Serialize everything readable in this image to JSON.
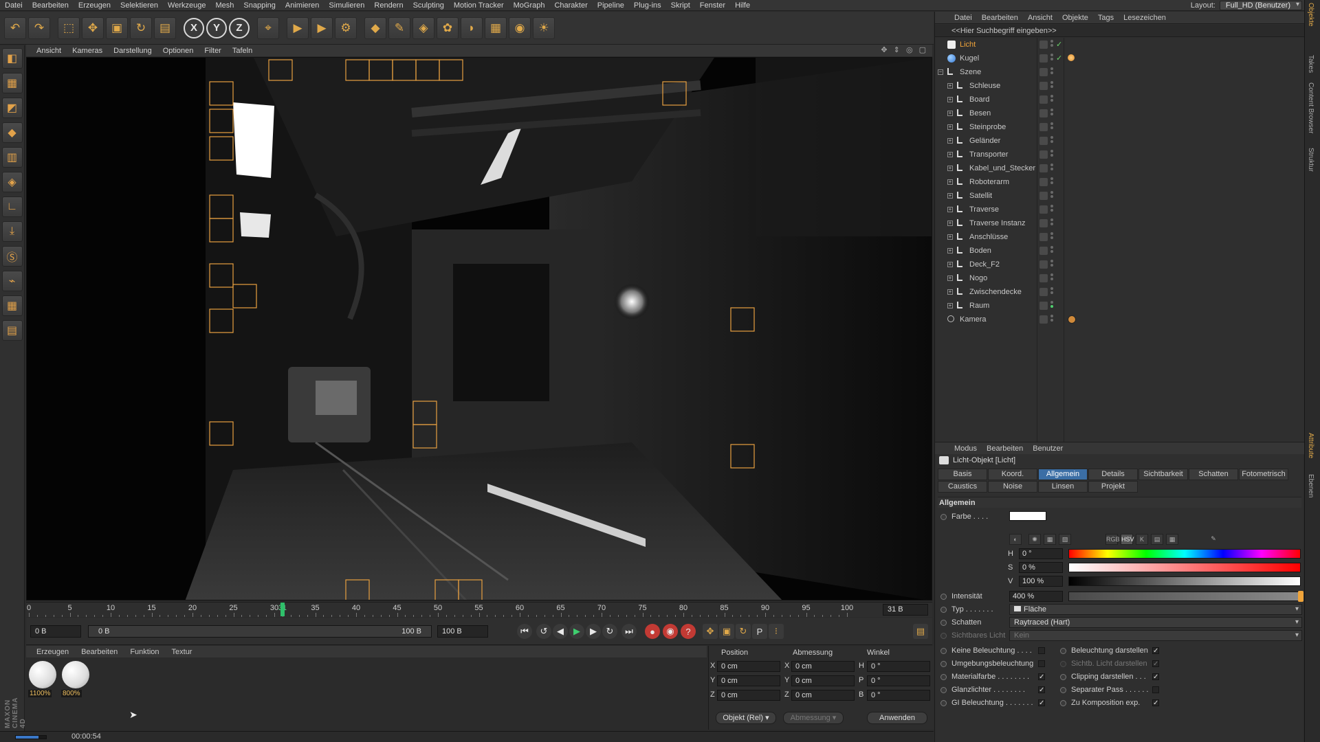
{
  "menubar": {
    "items": [
      "Datei",
      "Bearbeiten",
      "Erzeugen",
      "Selektieren",
      "Werkzeuge",
      "Mesh",
      "Snapping",
      "Animieren",
      "Simulieren",
      "Rendern",
      "Sculpting",
      "Motion Tracker",
      "MoGraph",
      "Charakter",
      "Pipeline",
      "Plug-ins",
      "Skript",
      "Fenster",
      "Hilfe"
    ],
    "layout_label": "Layout:",
    "layout_value": "Full_HD (Benutzer)"
  },
  "toolbar": {
    "icons": [
      "undo-icon",
      "redo-icon",
      "live-select-icon",
      "move-icon",
      "scale-icon",
      "rotate-icon",
      "render-region-icon",
      "x-axis-icon",
      "y-axis-icon",
      "z-axis-icon",
      "coordinate-system-icon",
      "render-view-icon",
      "render-picture-viewer-icon",
      "render-settings-icon",
      "cube-icon",
      "pen-icon",
      "subdivision-icon",
      "cloner-icon",
      "deformer-icon",
      "floor-icon",
      "camera-icon",
      "light-icon"
    ],
    "x_label": "X",
    "y_label": "Y",
    "z_label": "Z"
  },
  "lefttools": {
    "icons": [
      "model-mode-icon",
      "points-mode-icon",
      "edges-mode-icon",
      "polygons-mode-icon",
      "object-axis-icon",
      "texture-mode-icon",
      "workplane-icon",
      "snap-icon",
      "sculpt-icon",
      "magnet-icon",
      "grid-icon",
      "layer-icon"
    ]
  },
  "viewport": {
    "menu": [
      "Ansicht",
      "Kameras",
      "Darstellung",
      "Optionen",
      "Filter",
      "Tafeln"
    ]
  },
  "timeline": {
    "ticks": [
      "0",
      "5",
      "10",
      "15",
      "20",
      "25",
      "30",
      "31",
      "35",
      "40",
      "45",
      "50",
      "55",
      "60",
      "65",
      "70",
      "75",
      "80",
      "85",
      "90",
      "95",
      "100"
    ],
    "current_frame": "31 B",
    "playhead_frame": 31,
    "max_frame": 100
  },
  "playback": {
    "start_field": "0 B",
    "range_start": "0 B",
    "range_end": "100 B",
    "end_field": "100 B"
  },
  "material_manager": {
    "menu": [
      "Erzeugen",
      "Bearbeiten",
      "Funktion",
      "Textur"
    ],
    "materials": [
      {
        "tag": "1100%"
      },
      {
        "tag": "800%"
      }
    ]
  },
  "coordinates": {
    "headers": [
      "Position",
      "Abmessung",
      "Winkel"
    ],
    "rows": [
      {
        "pos_axis": "X",
        "pos": "0 cm",
        "size_axis": "X",
        "size": "0 cm",
        "rot_axis": "H",
        "rot": "0 °"
      },
      {
        "pos_axis": "Y",
        "pos": "0 cm",
        "size_axis": "Y",
        "size": "0 cm",
        "rot_axis": "P",
        "rot": "0 °"
      },
      {
        "pos_axis": "Z",
        "pos": "0 cm",
        "size_axis": "Z",
        "size": "0 cm",
        "rot_axis": "B",
        "rot": "0 °"
      }
    ],
    "mode": "Objekt (Rel)",
    "size_mode": "Abmessung",
    "apply": "Anwenden"
  },
  "statusbar": {
    "time": "00:00:54",
    "progress": 0.75
  },
  "object_manager": {
    "menu": [
      "Datei",
      "Bearbeiten",
      "Ansicht",
      "Objekte",
      "Tags",
      "Lesezeichen"
    ],
    "search_placeholder": "<<Hier Suchbegriff eingeben>>",
    "objects": [
      {
        "name": "Licht",
        "level": 0,
        "icon": "light",
        "selected": true,
        "color": "#f0a43a"
      },
      {
        "name": "Kugel",
        "level": 0,
        "icon": "sphere"
      },
      {
        "name": "Szene",
        "level": 0,
        "icon": "null",
        "expanded": true
      },
      {
        "name": "Schleuse",
        "level": 1,
        "icon": "null"
      },
      {
        "name": "Board",
        "level": 1,
        "icon": "null"
      },
      {
        "name": "Besen",
        "level": 1,
        "icon": "null"
      },
      {
        "name": "Steinprobe",
        "level": 1,
        "icon": "null"
      },
      {
        "name": "Geländer",
        "level": 1,
        "icon": "null"
      },
      {
        "name": "Transporter",
        "level": 1,
        "icon": "null"
      },
      {
        "name": "Kabel_und_Stecker",
        "level": 1,
        "icon": "null"
      },
      {
        "name": "Roboterarm",
        "level": 1,
        "icon": "null"
      },
      {
        "name": "Satellit",
        "level": 1,
        "icon": "null"
      },
      {
        "name": "Traverse",
        "level": 1,
        "icon": "null"
      },
      {
        "name": "Traverse Instanz",
        "level": 1,
        "icon": "null"
      },
      {
        "name": "Anschlüsse",
        "level": 1,
        "icon": "null"
      },
      {
        "name": "Boden",
        "level": 1,
        "icon": "null"
      },
      {
        "name": "Deck_F2",
        "level": 1,
        "icon": "null"
      },
      {
        "name": "Nogo",
        "level": 1,
        "icon": "null"
      },
      {
        "name": "Zwischendecke",
        "level": 1,
        "icon": "null"
      },
      {
        "name": "Raum",
        "level": 1,
        "icon": "null"
      },
      {
        "name": "Kamera",
        "level": 0,
        "icon": "camera"
      }
    ]
  },
  "attributes": {
    "menu": [
      "Modus",
      "Bearbeiten",
      "Benutzer"
    ],
    "title": "Licht-Objekt [Licht]",
    "tabs_row1": [
      "Basis",
      "Koord.",
      "Allgemein",
      "Details",
      "Sichtbarkeit",
      "Schatten",
      "Fotometrisch"
    ],
    "tabs_row2": [
      "Caustics",
      "Noise",
      "Linsen",
      "Projekt"
    ],
    "active_tab": "Allgemein",
    "section": "Allgemein",
    "farbe_label": "Farbe . . . .",
    "h_label": "H",
    "h_value": "0 °",
    "s_label": "S",
    "s_value": "0 %",
    "v_label": "V",
    "v_value": "100 %",
    "intensity_label": "Intensität",
    "intensity_value": "400 %",
    "intensity_fill": 1.0,
    "typ_label": "Typ . . . . . . .",
    "typ_value": "Fläche",
    "schatten_label": "Schatten",
    "schatten_value": "Raytraced (Hart)",
    "sichtbar_label": "Sichtbares Licht",
    "sichtbar_value": "Kein",
    "checks_left": [
      {
        "label": "Keine Beleuchtung . . . .",
        "checked": false
      },
      {
        "label": "Umgebungsbeleuchtung",
        "checked": false
      },
      {
        "label": "Materialfarbe . . . . . . . .",
        "checked": true
      },
      {
        "label": "Glanzlichter . . . . . . . .",
        "checked": true
      },
      {
        "label": "GI Beleuchtung . . . . . . .",
        "checked": true
      }
    ],
    "checks_right": [
      {
        "label": "Beleuchtung darstellen",
        "checked": true
      },
      {
        "label": "Sichtb. Licht darstellen",
        "checked": true,
        "dim": true
      },
      {
        "label": "Clipping darstellen . . .",
        "checked": true
      },
      {
        "label": "Separater Pass . . . . . .",
        "checked": false
      },
      {
        "label": "Zu Komposition exp.",
        "checked": true
      }
    ],
    "colors": {
      "accent": "#3b6ea5",
      "light_color": "#ffffff",
      "selected_object": "#f0a43a"
    }
  },
  "vtabs": [
    "Objekte",
    "Takes",
    "Content Browser",
    "Struktur",
    "Attribute",
    "Ebenen"
  ],
  "brand": "MAXON CINEMA 4D"
}
